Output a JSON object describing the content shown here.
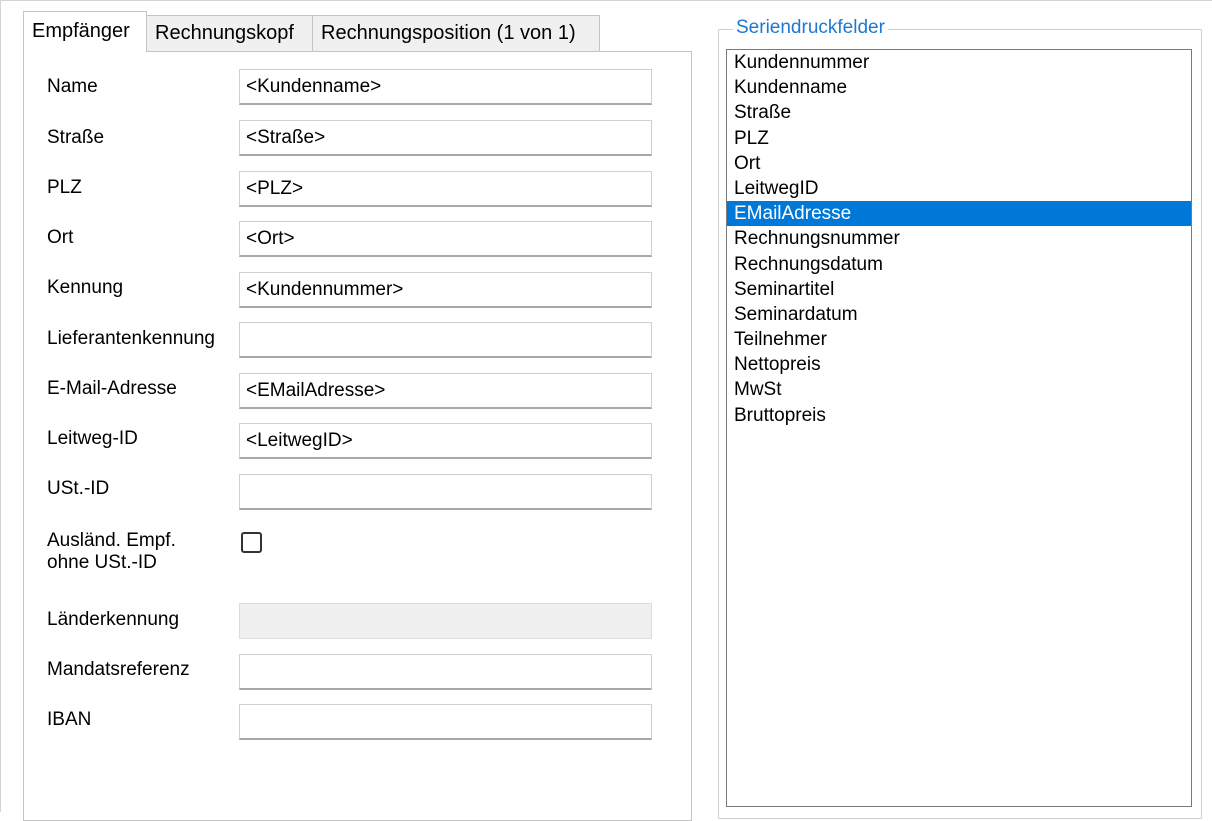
{
  "tabs": [
    {
      "label": "Empfänger",
      "active": true
    },
    {
      "label": "Rechnungskopf",
      "active": false
    },
    {
      "label": "Rechnungsposition (1 von 1)",
      "active": false
    }
  ],
  "form": {
    "name_label": "Name",
    "name_value": "<Kundenname>",
    "strasse_label": "Straße",
    "strasse_value": "<Straße>",
    "plz_label": "PLZ",
    "plz_value": "<PLZ>",
    "ort_label": "Ort",
    "ort_value": "<Ort>",
    "kennung_label": "Kennung",
    "kennung_value": "<Kundennummer>",
    "lieferantenkennung_label": "Lieferantenkennung",
    "lieferantenkennung_value": "",
    "email_label": "E-Mail-Adresse",
    "email_value": "<EMailAdresse>",
    "leitweg_label": "Leitweg-ID",
    "leitweg_value": "<LeitwegID>",
    "ust_label": "USt.-ID",
    "ust_value": "",
    "auslaend_label_line1": "Ausländ.  Empf.",
    "auslaend_label_line2": "ohne USt.-ID",
    "auslaend_checked": false,
    "laenderkennung_label": "Länderkennung",
    "laenderkennung_value": "",
    "laenderkennung_disabled": true,
    "mandat_label": "Mandatsreferenz",
    "mandat_value": "",
    "iban_label": "IBAN",
    "iban_value": ""
  },
  "seriendruck": {
    "title": "Seriendruckfelder",
    "selected_index": 6,
    "items": [
      "Kundennummer",
      "Kundenname",
      "Straße",
      "PLZ",
      "Ort",
      "LeitwegID",
      "EMailAdresse",
      "Rechnungsnummer",
      "Rechnungsdatum",
      "Seminartitel",
      "Seminardatum",
      "Teilnehmer",
      "Nettopreis",
      "MwSt",
      "Bruttopreis"
    ]
  },
  "colors": {
    "selection": "#0078d7",
    "group_title": "#1e78d2",
    "tab_inactive": "#f0f0f0"
  }
}
